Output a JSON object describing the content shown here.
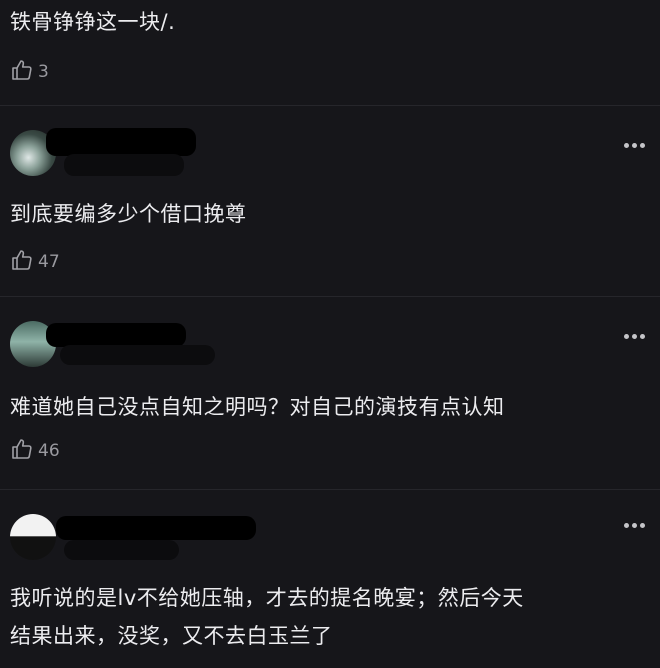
{
  "comments": [
    {
      "text": "铁骨铮铮这一块/.",
      "likes": "3"
    },
    {
      "text": "到底要编多少个借口挽尊",
      "likes": "47"
    },
    {
      "text": "难道她自己没点自知之明吗？对自己的演技有点认知",
      "likes": "46"
    },
    {
      "text_line1": "我听说的是lv不给她压轴，才去的提名晚宴；然后今天",
      "text_line2": "结果出来，没奖，又不去白玉兰了"
    }
  ],
  "icons": {
    "like": "thumbs-up-icon",
    "more": "more-options-icon"
  }
}
